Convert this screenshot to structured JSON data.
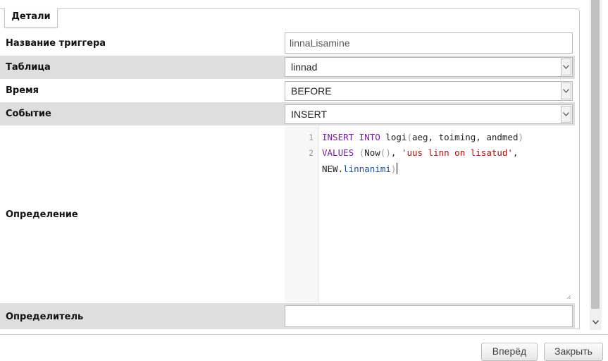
{
  "panel": {
    "legend": "Детали"
  },
  "fields": {
    "trigger_name": {
      "label": "Название триггера",
      "value": "linnaLisamine"
    },
    "table": {
      "label": "Таблица",
      "value": "linnad"
    },
    "time": {
      "label": "Время",
      "value": "BEFORE"
    },
    "event": {
      "label": "Событие",
      "value": "INSERT"
    },
    "definition": {
      "label": "Определение",
      "line_numbers": [
        "1",
        "2"
      ],
      "lines": [
        {
          "kw1": "INSERT INTO",
          "t1": " logi",
          "b1": "(",
          "t2": "aeg, toiming, andmed",
          "b2": ")"
        },
        {
          "kw1": "VALUES",
          "t1": " ",
          "b1": "(",
          "t2": "Now",
          "b2": "()",
          "t3": ", ",
          "str": "'uus linn on lisatud'",
          "t4": ","
        },
        {
          "t1": "NEW.",
          "prop": "linnanimi",
          "b1": ")"
        }
      ]
    },
    "definer": {
      "label": "Определитель",
      "value": ""
    }
  },
  "buttons": {
    "next": "Вперёд",
    "close": "Закрыть"
  },
  "icons": {
    "select_arrow": "chevron-down-icon",
    "scroll_down": "chevron-down-icon",
    "resize": "resize-grip-icon"
  }
}
